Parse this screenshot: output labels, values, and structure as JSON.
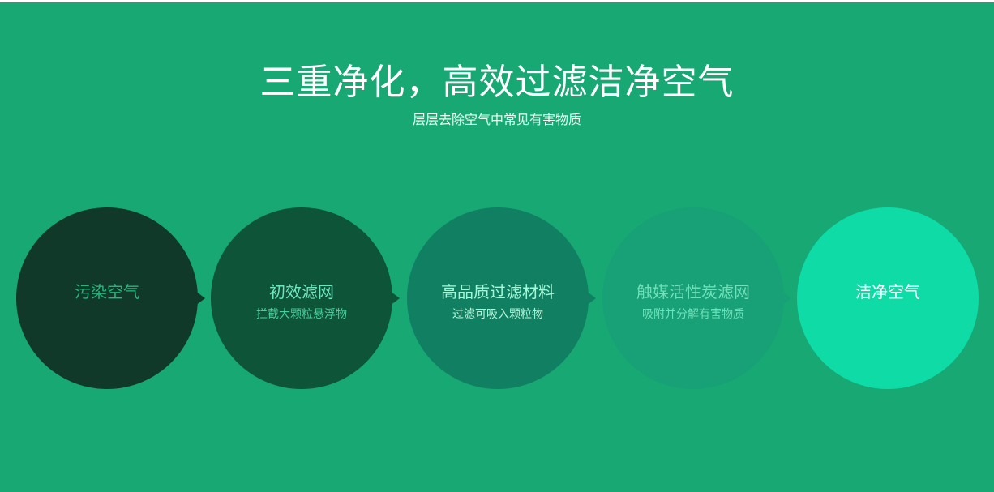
{
  "header": {
    "title": "三重净化，高效过滤洁净空气",
    "subtitle": "层层去除空气中常见有害物质"
  },
  "steps": [
    {
      "label": "污染空气",
      "desc": ""
    },
    {
      "label": "初效滤网",
      "desc": "拦截大颗粒悬浮物"
    },
    {
      "label": "高品质过滤材料",
      "desc": "过滤可吸入颗粒物"
    },
    {
      "label": "触媒活性炭滤网",
      "desc": "吸附并分解有害物质"
    },
    {
      "label": "洁净空气",
      "desc": ""
    }
  ],
  "colors": {
    "background": "#17a873",
    "step1": "#11392a",
    "step2": "#0e5439",
    "step3": "#117f61",
    "step4": "#18a077",
    "step5": "#0edba6"
  }
}
